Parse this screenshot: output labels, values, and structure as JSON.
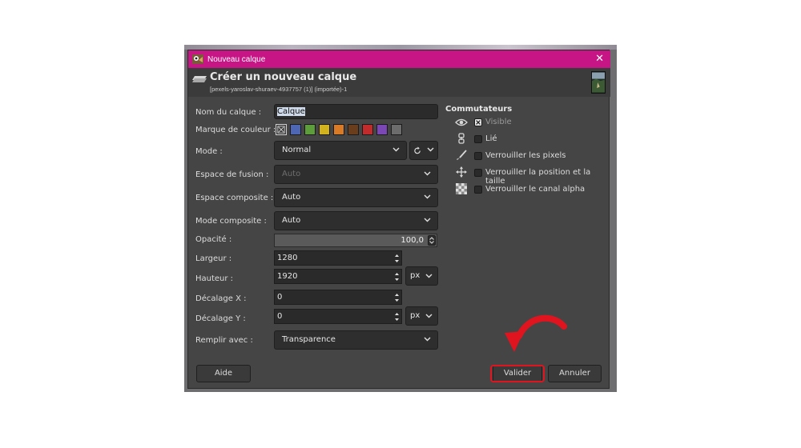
{
  "window": {
    "title": "Nouveau calque",
    "close_glyph": "✕",
    "title_bar_color": "#c71585",
    "app_icon": "gimp-wilber-icon"
  },
  "header": {
    "title": "Créer un nouveau calque",
    "subtitle": "[pexels-yaroslav-shuraev-4937757 (1)] (importée)-1",
    "icon": "new-layer-icon"
  },
  "form": {
    "layer_name_label": "Nom du calque :",
    "layer_name_value": "Calque",
    "color_tag_label": "Marque de couleur :",
    "color_tags": [
      {
        "name": "none",
        "color": "#cfcfcf"
      },
      {
        "name": "blue",
        "color": "#4d67b4"
      },
      {
        "name": "green",
        "color": "#5d9d3b"
      },
      {
        "name": "yellow",
        "color": "#d2b21d"
      },
      {
        "name": "orange",
        "color": "#d97a26"
      },
      {
        "name": "brown",
        "color": "#6a3d1c"
      },
      {
        "name": "red",
        "color": "#c22b2b"
      },
      {
        "name": "violet",
        "color": "#7a47b4"
      },
      {
        "name": "gray",
        "color": "#6c6c6c"
      }
    ],
    "mode_label": "Mode :",
    "mode_value": "Normal",
    "blend_space_label": "Espace de fusion :",
    "blend_space_value": "Auto",
    "composite_space_label": "Espace composite :",
    "composite_space_value": "Auto",
    "composite_mode_label": "Mode composite :",
    "composite_mode_value": "Auto",
    "opacity_label": "Opacité :",
    "opacity_value": "100,0",
    "width_label": "Largeur :",
    "width_value": "1280",
    "height_label": "Hauteur :",
    "height_value": "1920",
    "size_unit": "px",
    "offset_x_label": "Décalage X :",
    "offset_x_value": "0",
    "offset_y_label": "Décalage Y :",
    "offset_y_value": "0",
    "offset_unit": "px",
    "fill_label": "Remplir avec :",
    "fill_value": "Transparence"
  },
  "switches": {
    "title": "Commutateurs",
    "items": [
      {
        "label": "Visible",
        "checked": true,
        "icon": "eye-icon"
      },
      {
        "label": "Lié",
        "checked": false,
        "icon": "chain-link-icon"
      },
      {
        "label": "Verrouiller les pixels",
        "checked": false,
        "icon": "paintbrush-icon"
      },
      {
        "label": "Verrouiller la position et la taille",
        "checked": false,
        "icon": "move-arrows-icon"
      },
      {
        "label": "Verrouiller le canal alpha",
        "checked": false,
        "icon": "checkerboard-icon"
      }
    ]
  },
  "buttons": {
    "help": "Aide",
    "ok": "Valider",
    "cancel": "Annuler"
  },
  "annotation": {
    "highlight_color": "#e0141f"
  }
}
